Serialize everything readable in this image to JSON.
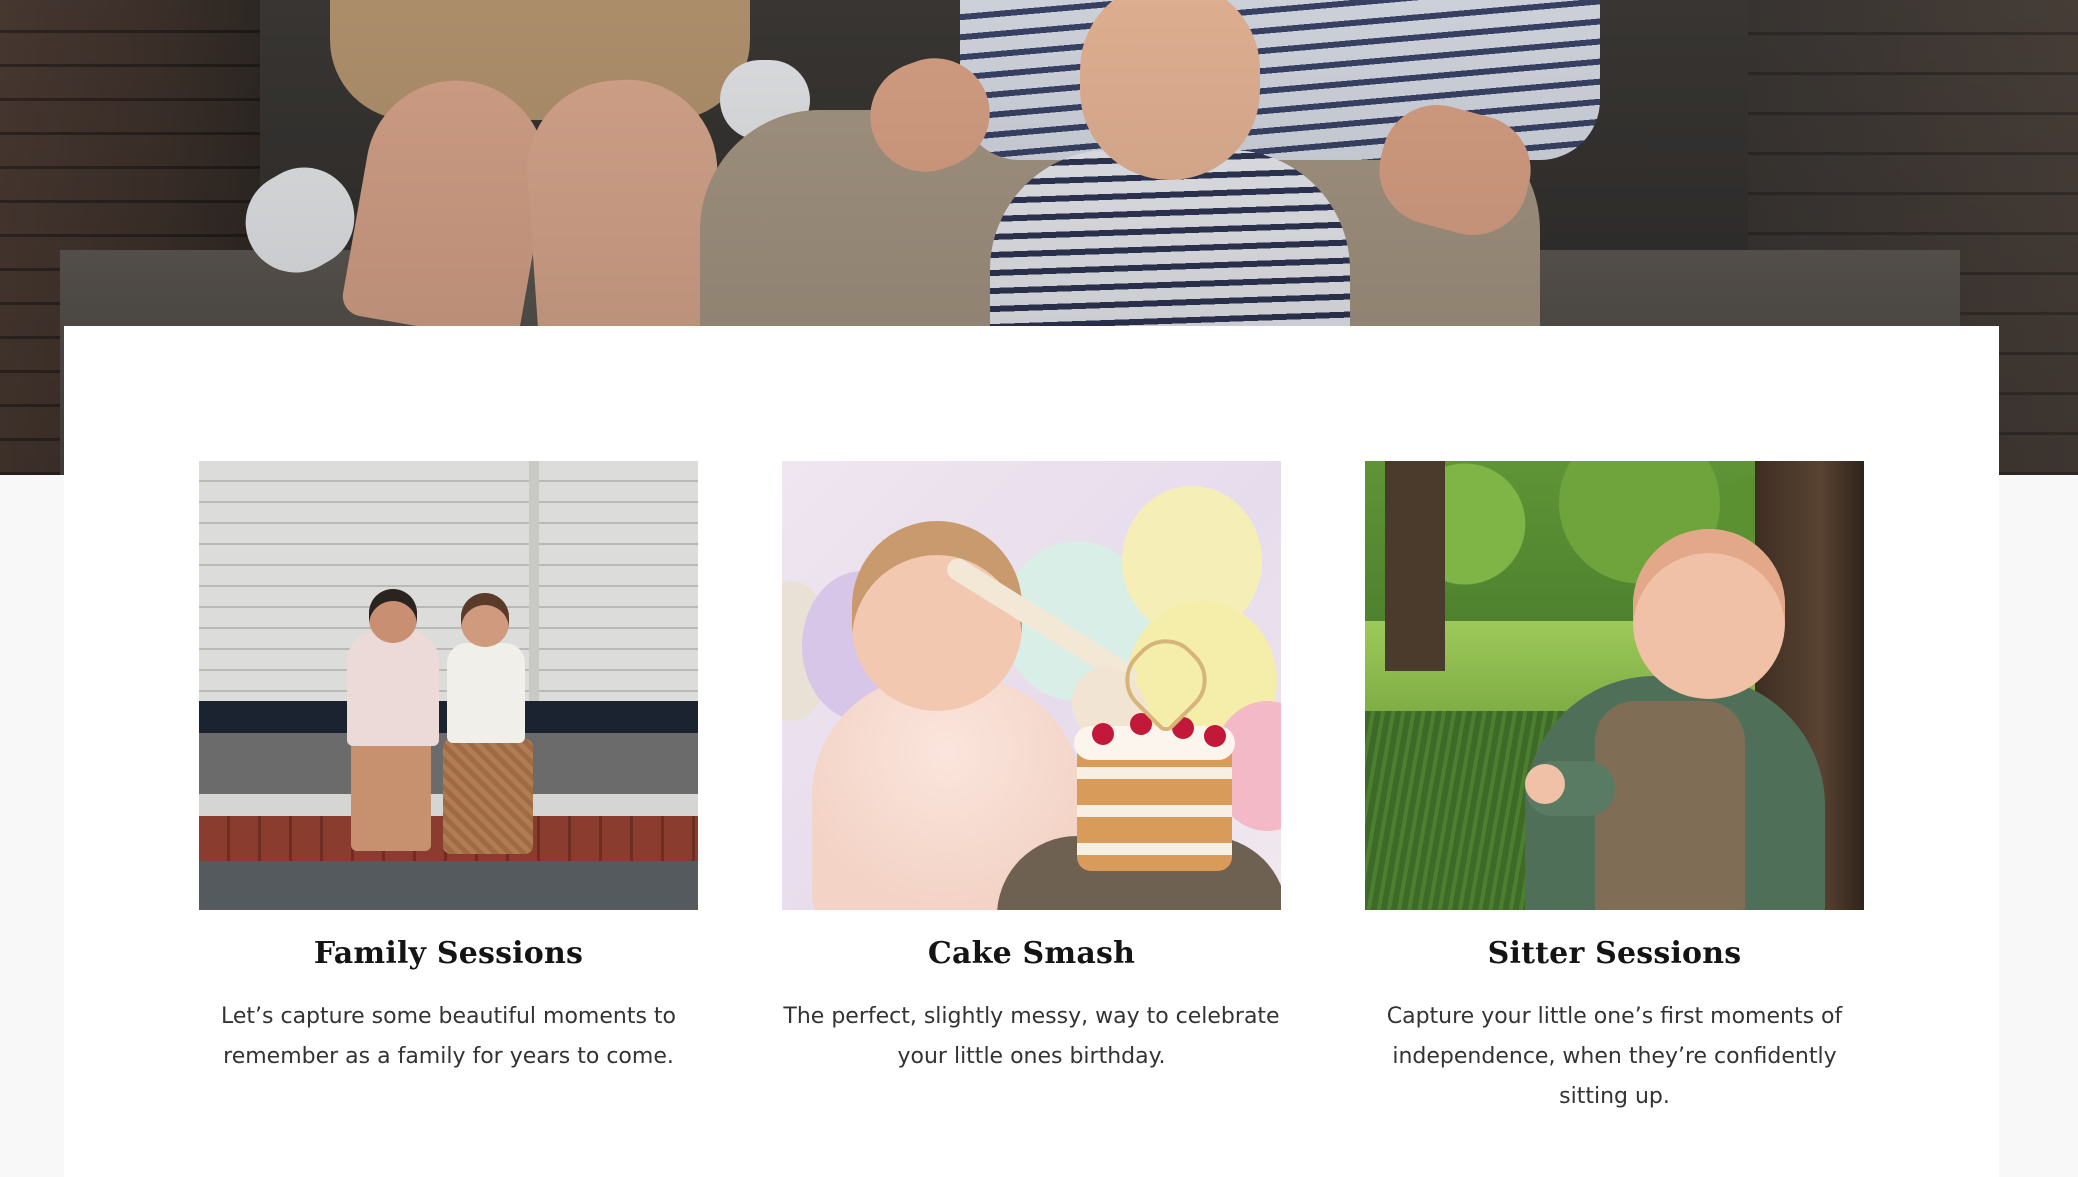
{
  "sessions": [
    {
      "title": "Family Sessions",
      "description": "Let’s capture some beautiful moments to remember as a family for years to come."
    },
    {
      "title": "Cake Smash",
      "description": "The perfect, slightly messy, way to celebrate your little ones birthday."
    },
    {
      "title": "Sitter Sessions",
      "description": "Capture your little one’s first moments of independence, when they’re confidently sitting up."
    }
  ],
  "colors": {
    "page_background": "#f7f8f7",
    "panel_background": "#ffffff",
    "title_text": "#141414",
    "body_text": "#333333"
  }
}
